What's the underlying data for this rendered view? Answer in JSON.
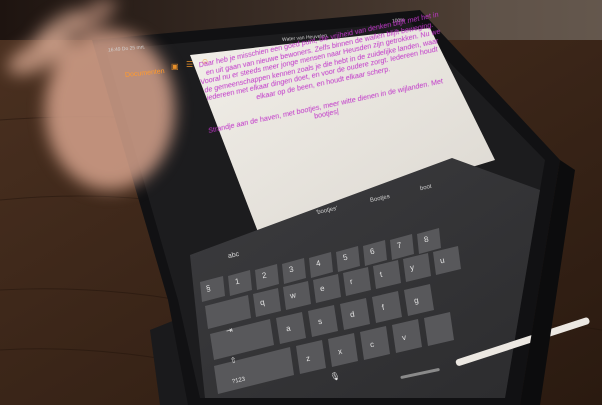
{
  "scene": {
    "description_colors": {
      "table": "#3a2618",
      "tablet_frame": "#141416",
      "page": "#e9e5df",
      "keyboard": "#3a3a3c",
      "key": "#5a5a5c",
      "text_purple": "#c035c9",
      "accent_orange": "#ff9a2e",
      "skin": "#d8a48e"
    }
  },
  "status_bar": {
    "time": "16:49 Do 25 mrt.",
    "battery": "100%"
  },
  "app": {
    "back_label": "Documenten",
    "doc_title": "Water van Heuvelen",
    "icons": [
      "sidebar-icon",
      "list-icon",
      "smiley-icon"
    ]
  },
  "document": {
    "paragraph1": "Daar heb je misschien een goed punt, die vrijheid van denken blijft met het in en uit gaan van nieuwe bewoners. Zelfs binnen de wallen blijft beweging. Vooral nu er steeds meer jonge mensen naar Heusden zijn getrokken. Nu we de gemeenschappen kennen zoals je die hebt in de zuidelijke landen, waar iedereen met elkaar dingen doet, en voor de oudere zorgt. Iedereen houdt elkaar op de been, en houdt elkaar scherp.",
    "paragraph2": "Strandje aan de haven, met bootjes, meer witte dienen in de wijlanden. Met bootjes|"
  },
  "keyboard": {
    "suggestions": [
      "'bootjes'",
      "Bootjes",
      "boot"
    ],
    "mode_label": "abc",
    "row1": [
      "§",
      "1",
      "2",
      "3",
      "4",
      "5",
      "6",
      "7",
      "8",
      "9",
      "0"
    ],
    "row2": [
      "q",
      "w",
      "e",
      "r",
      "t",
      "y",
      "u",
      "i",
      "o",
      "p"
    ],
    "row3": [
      "a",
      "s",
      "d",
      "f",
      "g",
      "h",
      "j",
      "k",
      "l"
    ],
    "row4": [
      "<",
      "z",
      "x",
      "c",
      "v",
      "b",
      "n",
      "m"
    ],
    "bottom": [
      "?123",
      "mic"
    ]
  }
}
